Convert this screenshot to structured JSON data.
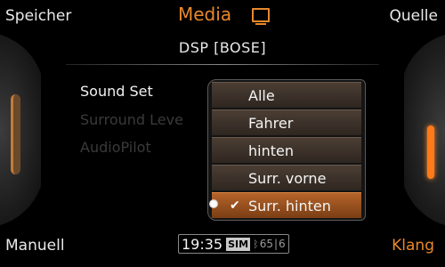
{
  "softkeys": {
    "top_left": "Speicher",
    "top_center": "Media",
    "top_right": "Quelle",
    "bottom_left": "Manuell",
    "bottom_right": "Klang"
  },
  "panel": {
    "title": "DSP [BOSE]",
    "items": [
      "Sound Set",
      "Surround Leve",
      "AudioPilot"
    ]
  },
  "dropdown": {
    "options": [
      "Alle",
      "Fahrer",
      "hinten",
      "Surr. vorne",
      "Surr. hinten"
    ],
    "selected_index": 4,
    "check_mark": "✔"
  },
  "status": {
    "time": "19:35",
    "sim": "SIM",
    "bluetooth": "ᛒ",
    "signal": "65",
    "separator": "|",
    "network": "6"
  },
  "colors": {
    "accent": "#e8882c",
    "selected": "#b5642a"
  }
}
